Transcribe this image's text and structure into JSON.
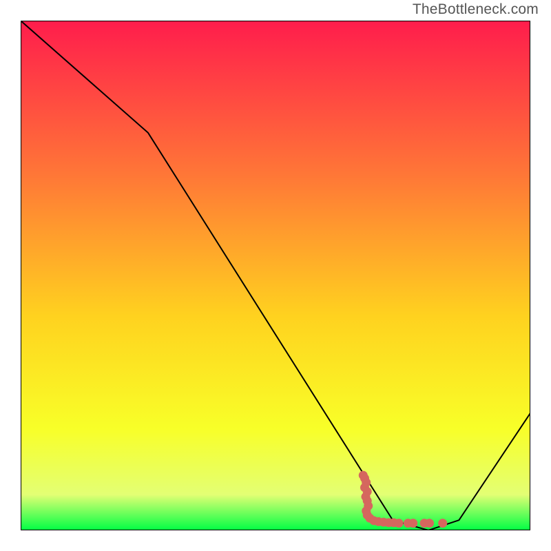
{
  "watermark": "TheBottleneck.com",
  "chart_data": {
    "type": "line",
    "title": "",
    "xlabel": "",
    "ylabel": "",
    "xlim": [
      0,
      100
    ],
    "ylim": [
      0,
      100
    ],
    "grid": false,
    "series": [
      {
        "name": "bottleneck-curve",
        "color": "#000000",
        "segments": [
          {
            "x1": 0,
            "y1": 100,
            "x2": 25,
            "y2": 78,
            "type": "line"
          },
          {
            "x1": 25,
            "y1": 78,
            "x2": 73,
            "y2": 2,
            "type": "line"
          },
          {
            "cx1": 73,
            "cy1": 2,
            "cx2": 75,
            "cy2": 0,
            "x2": 80,
            "y2": 0,
            "type": "curve"
          },
          {
            "cx1": 80,
            "cy1": 0,
            "cx2": 84,
            "cy2": 0,
            "x2": 86,
            "y2": 2,
            "type": "curve"
          },
          {
            "x1": 86,
            "y1": 2,
            "x2": 100,
            "y2": 23,
            "type": "line"
          }
        ]
      }
    ],
    "scatter": {
      "name": "ideal-zone",
      "color": "#d5675e",
      "points": [
        {
          "x": 67.2,
          "y": 10.8
        },
        {
          "x": 67.5,
          "y": 10.2
        },
        {
          "x": 67.8,
          "y": 9.4
        },
        {
          "x": 67.5,
          "y": 8.4
        },
        {
          "x": 68.0,
          "y": 7.6
        },
        {
          "x": 67.7,
          "y": 6.6
        },
        {
          "x": 68.0,
          "y": 5.8
        },
        {
          "x": 68.2,
          "y": 4.8
        },
        {
          "x": 67.8,
          "y": 3.8
        },
        {
          "x": 68.0,
          "y": 3.0
        },
        {
          "x": 68.5,
          "y": 2.4
        },
        {
          "x": 69.3,
          "y": 1.9
        },
        {
          "x": 70.2,
          "y": 1.7
        },
        {
          "x": 71.2,
          "y": 1.6
        },
        {
          "x": 72.2,
          "y": 1.5
        },
        {
          "x": 73.2,
          "y": 1.5
        },
        {
          "x": 74.2,
          "y": 1.4
        },
        {
          "x": 76.0,
          "y": 1.4
        },
        {
          "x": 77.0,
          "y": 1.4
        },
        {
          "x": 79.2,
          "y": 1.4
        },
        {
          "x": 80.2,
          "y": 1.4
        },
        {
          "x": 82.8,
          "y": 1.4
        }
      ]
    },
    "background_gradient": {
      "top_color": "#ff1d4c",
      "upper_mid_color": "#ff7637",
      "mid_color": "#ffd21f",
      "lower_mid_color": "#f8ff28",
      "near_bottom_color": "#e3ff74",
      "bottom_color": "#00ff44"
    }
  }
}
